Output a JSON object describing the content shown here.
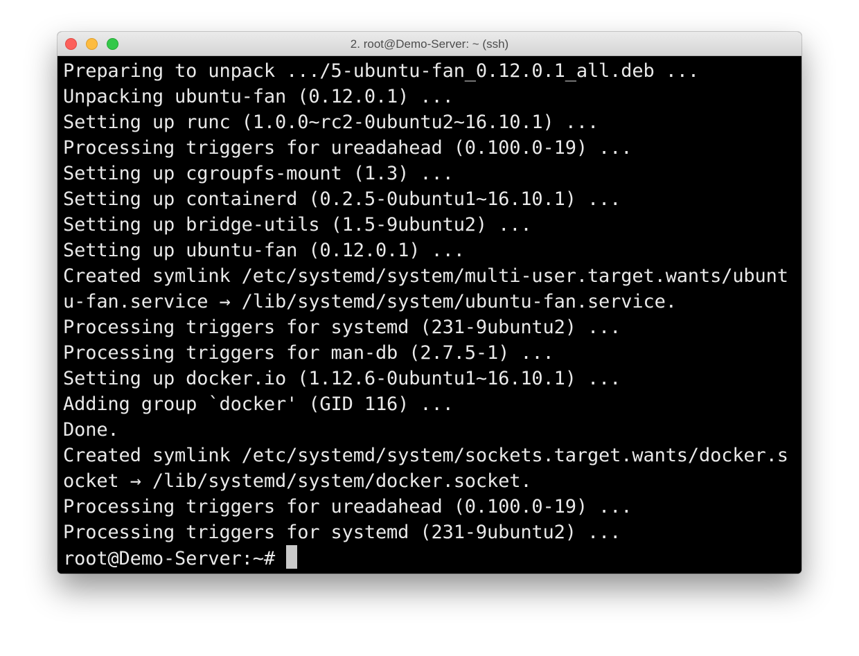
{
  "window": {
    "title": "2. root@Demo-Server: ~ (ssh)"
  },
  "terminal": {
    "lines": [
      "Preparing to unpack .../5-ubuntu-fan_0.12.0.1_all.deb ...",
      "Unpacking ubuntu-fan (0.12.0.1) ...",
      "Setting up runc (1.0.0~rc2-0ubuntu2~16.10.1) ...",
      "Processing triggers for ureadahead (0.100.0-19) ...",
      "Setting up cgroupfs-mount (1.3) ...",
      "Setting up containerd (0.2.5-0ubuntu1~16.10.1) ...",
      "Setting up bridge-utils (1.5-9ubuntu2) ...",
      "Setting up ubuntu-fan (0.12.0.1) ...",
      "Created symlink /etc/systemd/system/multi-user.target.wants/ubunt",
      "u-fan.service → /lib/systemd/system/ubuntu-fan.service.",
      "Processing triggers for systemd (231-9ubuntu2) ...",
      "Processing triggers for man-db (2.7.5-1) ...",
      "Setting up docker.io (1.12.6-0ubuntu1~16.10.1) ...",
      "Adding group `docker' (GID 116) ...",
      "Done.",
      "Created symlink /etc/systemd/system/sockets.target.wants/docker.s",
      "ocket → /lib/systemd/system/docker.socket.",
      "Processing triggers for ureadahead (0.100.0-19) ...",
      "Processing triggers for systemd (231-9ubuntu2) ..."
    ],
    "prompt": "root@Demo-Server:~#"
  },
  "colors": {
    "background": "#000000",
    "foreground": "#e9e9e9",
    "close_button": "#fc605b",
    "minimize_button": "#fdbc40",
    "zoom_button": "#34c84a"
  }
}
